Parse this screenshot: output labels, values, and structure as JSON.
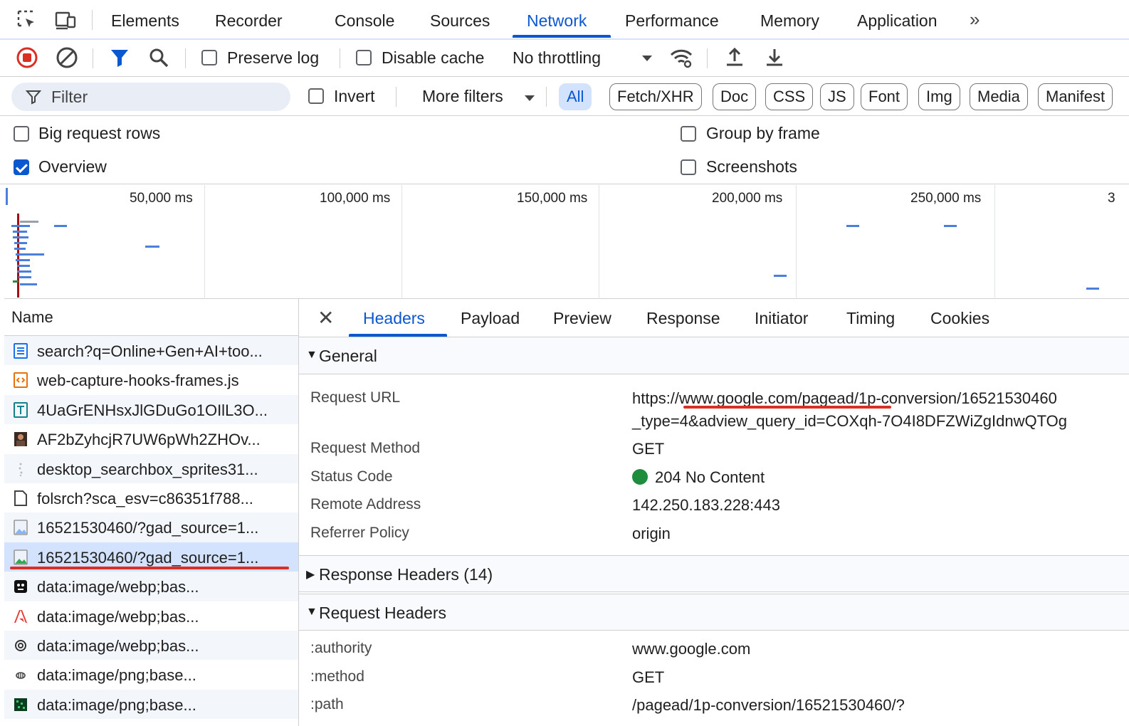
{
  "main_tabs": [
    "Elements",
    "Recorder",
    "Console",
    "Sources",
    "Network",
    "Performance",
    "Memory",
    "Application"
  ],
  "active_tab": "Network",
  "more_tabs_glyph": "»",
  "toolbar": {
    "preserve_log": "Preserve log",
    "disable_cache": "Disable cache",
    "throttling": "No throttling",
    "preserve_log_checked": false,
    "disable_cache_checked": false
  },
  "filter": {
    "placeholder": "Filter",
    "invert": "Invert",
    "more_filters": "More filters",
    "chips": [
      "All",
      "Fetch/XHR",
      "Doc",
      "CSS",
      "JS",
      "Font",
      "Img",
      "Media",
      "Manifest"
    ],
    "active_chip": "All"
  },
  "settings": {
    "big_request_rows": "Big request rows",
    "overview": "Overview",
    "group_by_frame": "Group by frame",
    "screenshots": "Screenshots",
    "overview_checked": true
  },
  "overview": {
    "ticks": [
      "50,000 ms",
      "100,000 ms",
      "150,000 ms",
      "200,000 ms",
      "250,000 ms",
      "3"
    ]
  },
  "name_column": {
    "header": "Name",
    "rows": [
      {
        "text": "search?q=Online+Gen+AI+too...",
        "icon": "document-icon"
      },
      {
        "text": "web-capture-hooks-frames.js",
        "icon": "script-icon"
      },
      {
        "text": "4UaGrENHsxJlGDuGo1OIlL3O...",
        "icon": "font-icon"
      },
      {
        "text": "AF2bZyhcjR7UW6pWh2ZHOv...",
        "icon": "image-thumb-icon"
      },
      {
        "text": "desktop_searchbox_sprites31...",
        "icon": "sprite-icon"
      },
      {
        "text": "folsrch?sca_esv=c86351f788...",
        "icon": "file-icon"
      },
      {
        "text": "16521530460/?gad_source=1...",
        "icon": "image-icon"
      },
      {
        "text": "16521530460/?gad_source=1...",
        "icon": "image-icon"
      },
      {
        "text": "data:image/webp;bas...",
        "icon": "webp-dark-icon"
      },
      {
        "text": "data:image/webp;bas...",
        "icon": "adobe-icon"
      },
      {
        "text": "data:image/webp;bas...",
        "icon": "openai-icon"
      },
      {
        "text": "data:image/png;base...",
        "icon": "bee-icon"
      },
      {
        "text": "data:image/png;base...",
        "icon": "green-pattern-icon"
      }
    ],
    "selected_index": 7
  },
  "details": {
    "tabs": [
      "Headers",
      "Payload",
      "Preview",
      "Response",
      "Initiator",
      "Timing",
      "Cookies"
    ],
    "active_tab": "Headers",
    "general_title": "General",
    "general": [
      {
        "key": "Request URL",
        "value": "https://www.google.com/pagead/1p-conversion/16521530460",
        "value2": "_type=4&adview_query_id=COXqh-7O4I8DFZWiZgIdnwQTOg"
      },
      {
        "key": "Request Method",
        "value": "GET"
      },
      {
        "key": "Status Code",
        "value": "204 No Content"
      },
      {
        "key": "Remote Address",
        "value": "142.250.183.228:443"
      },
      {
        "key": "Referrer Policy",
        "value": "origin"
      }
    ],
    "response_headers_title": "Response Headers (14)",
    "request_headers_title": "Request Headers",
    "request_headers": [
      {
        "key": ":authority",
        "value": "www.google.com"
      },
      {
        "key": ":method",
        "value": "GET"
      },
      {
        "key": ":path",
        "value": "/pagead/1p-conversion/16521530460/?"
      }
    ]
  },
  "colors": {
    "accent": "#0b57d0",
    "selected_bg": "#d3e3fd",
    "annotation_red": "#d93025",
    "status_green": "#1e8e3e"
  }
}
